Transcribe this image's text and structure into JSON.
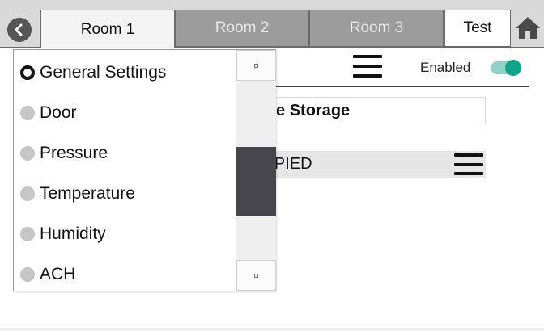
{
  "tabs": {
    "items": [
      {
        "label": "Room 1",
        "state": "active"
      },
      {
        "label": "Room 2",
        "state": "inactive"
      },
      {
        "label": "Room 3",
        "state": "inactive"
      },
      {
        "label": "Test",
        "state": "highlighted"
      }
    ],
    "back_icon": "chevron-left-icon",
    "home_icon": "home-icon"
  },
  "settings_panel": {
    "enabled_label": "Enabled",
    "enabled": true,
    "room_name": "erile Storage",
    "status": "CUPIED"
  },
  "dropdown": {
    "items": [
      {
        "label": "General Settings",
        "selected": true
      },
      {
        "label": "Door",
        "selected": false
      },
      {
        "label": "Pressure",
        "selected": false
      },
      {
        "label": "Temperature",
        "selected": false
      },
      {
        "label": "Humidity",
        "selected": false
      },
      {
        "label": "ACH",
        "selected": false
      }
    ],
    "scroll_position": 0.6
  },
  "colors": {
    "toggle_on": "#0fa388",
    "toggle_track": "#8fd3c6",
    "tab_active": "#f4f4f4",
    "tab_inactive": "#9c9c9c",
    "scroll_thumb": "#47464d"
  }
}
